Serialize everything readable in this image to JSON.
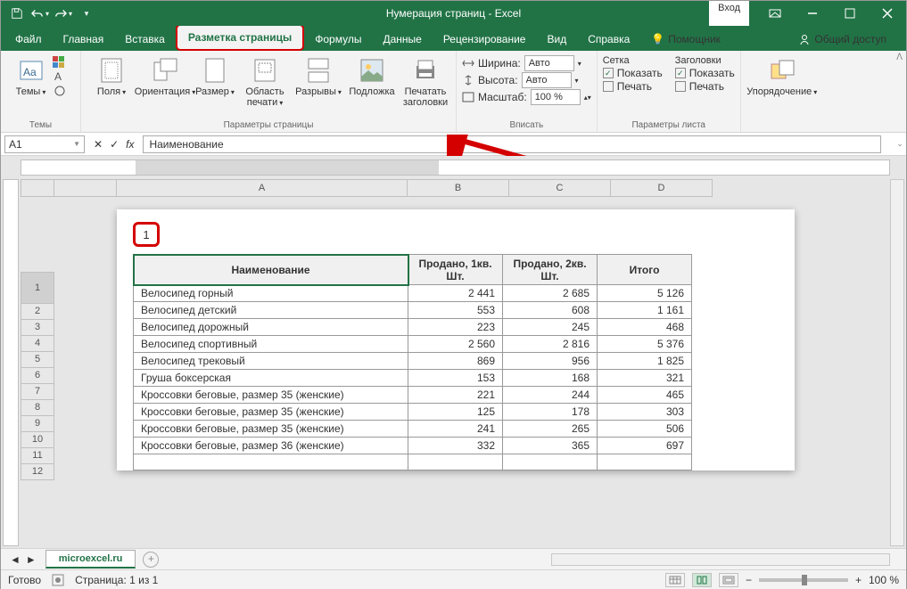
{
  "title": "Нумерация страниц - Excel",
  "login": "Вход",
  "tabs": {
    "file": "Файл",
    "home": "Главная",
    "insert": "Вставка",
    "pagelayout": "Разметка страницы",
    "formulas": "Формулы",
    "data": "Данные",
    "review": "Рецензирование",
    "view": "Вид",
    "help": "Справка",
    "tellme": "Помощник",
    "share": "Общий доступ"
  },
  "ribbon": {
    "themes": {
      "themes": "Темы",
      "label": "Темы"
    },
    "pagesetup": {
      "margins": "Поля",
      "orientation": "Ориентация",
      "size": "Размер",
      "printarea": "Область печати",
      "breaks": "Разрывы",
      "background": "Подложка",
      "printtitles": "Печатать заголовки",
      "label": "Параметры страницы"
    },
    "scale": {
      "width": "Ширина:",
      "height": "Высота:",
      "scale": "Масштаб:",
      "auto": "Авто",
      "percent": "100 %",
      "label": "Вписать"
    },
    "sheet": {
      "grid": "Сетка",
      "headings": "Заголовки",
      "show": "Показать",
      "print": "Печать",
      "label": "Параметры листа"
    },
    "arrange": {
      "arrange": "Упорядочение"
    }
  },
  "namebox": "A1",
  "formula": "Наименование",
  "cols": {
    "A": "A",
    "B": "B",
    "C": "C",
    "D": "D"
  },
  "page_number": "1",
  "table": {
    "h1": "Наименование",
    "h2": "Продано, 1кв. Шт.",
    "h3": "Продано, 2кв. Шт.",
    "h4": "Итого",
    "rows": [
      {
        "n": "Велосипед горный",
        "a": "2 441",
        "b": "2 685",
        "c": "5 126"
      },
      {
        "n": "Велосипед детский",
        "a": "553",
        "b": "608",
        "c": "1 161"
      },
      {
        "n": "Велосипед дорожный",
        "a": "223",
        "b": "245",
        "c": "468"
      },
      {
        "n": "Велосипед спортивный",
        "a": "2 560",
        "b": "2 816",
        "c": "5 376"
      },
      {
        "n": "Велосипед трековый",
        "a": "869",
        "b": "956",
        "c": "1 825"
      },
      {
        "n": "Груша боксерская",
        "a": "153",
        "b": "168",
        "c": "321"
      },
      {
        "n": "Кроссовки беговые, размер 35 (женские)",
        "a": "221",
        "b": "244",
        "c": "465"
      },
      {
        "n": "Кроссовки беговые, размер 35 (женские)",
        "a": "125",
        "b": "178",
        "c": "303"
      },
      {
        "n": "Кроссовки беговые, размер 35 (женские)",
        "a": "241",
        "b": "265",
        "c": "506"
      },
      {
        "n": "Кроссовки беговые, размер 36 (женские)",
        "a": "332",
        "b": "365",
        "c": "697"
      },
      {
        "n": "",
        "a": "",
        "b": "",
        "c": ""
      }
    ]
  },
  "sheet_tab": "microexcel.ru",
  "status": {
    "ready": "Готово",
    "page": "Страница: 1 из 1",
    "zoom": "100 %"
  }
}
